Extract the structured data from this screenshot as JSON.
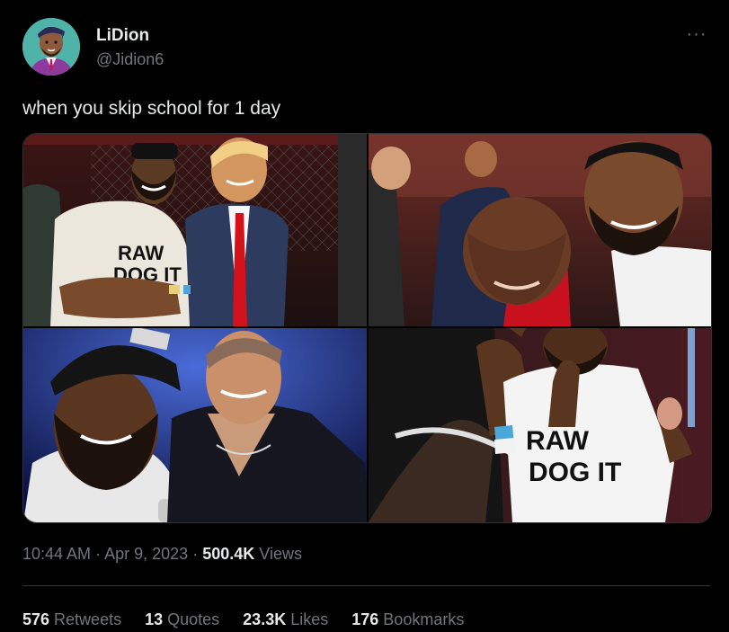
{
  "author": {
    "name": "LiDion",
    "handle": "@Jidion6",
    "avatar": "cartoon-avatar"
  },
  "more_icon": "more-horizontal-icon",
  "more_glyph": "···",
  "tweet": {
    "text": "when you skip school for 1 day"
  },
  "media": {
    "photos": [
      {
        "name": "photo-1",
        "shirt_text_1": "RAW",
        "shirt_text_2": "DOG IT"
      },
      {
        "name": "photo-2"
      },
      {
        "name": "photo-3"
      },
      {
        "name": "photo-4",
        "shirt_text_1": "RAW",
        "shirt_text_2": "DOG IT"
      }
    ]
  },
  "meta": {
    "time": "10:44 AM",
    "separator": "·",
    "date": "Apr 9, 2023",
    "views_count": "500.4K",
    "views_label": "Views"
  },
  "stats": {
    "retweets_count": "576",
    "retweets_label": "Retweets",
    "quotes_count": "13",
    "quotes_label": "Quotes",
    "likes_count": "23.3K",
    "likes_label": "Likes",
    "bookmarks_count": "176",
    "bookmarks_label": "Bookmarks"
  },
  "colors": {
    "background": "#000000",
    "text_primary": "#e7e9ea",
    "text_secondary": "#71767b",
    "border": "#2f3336"
  }
}
